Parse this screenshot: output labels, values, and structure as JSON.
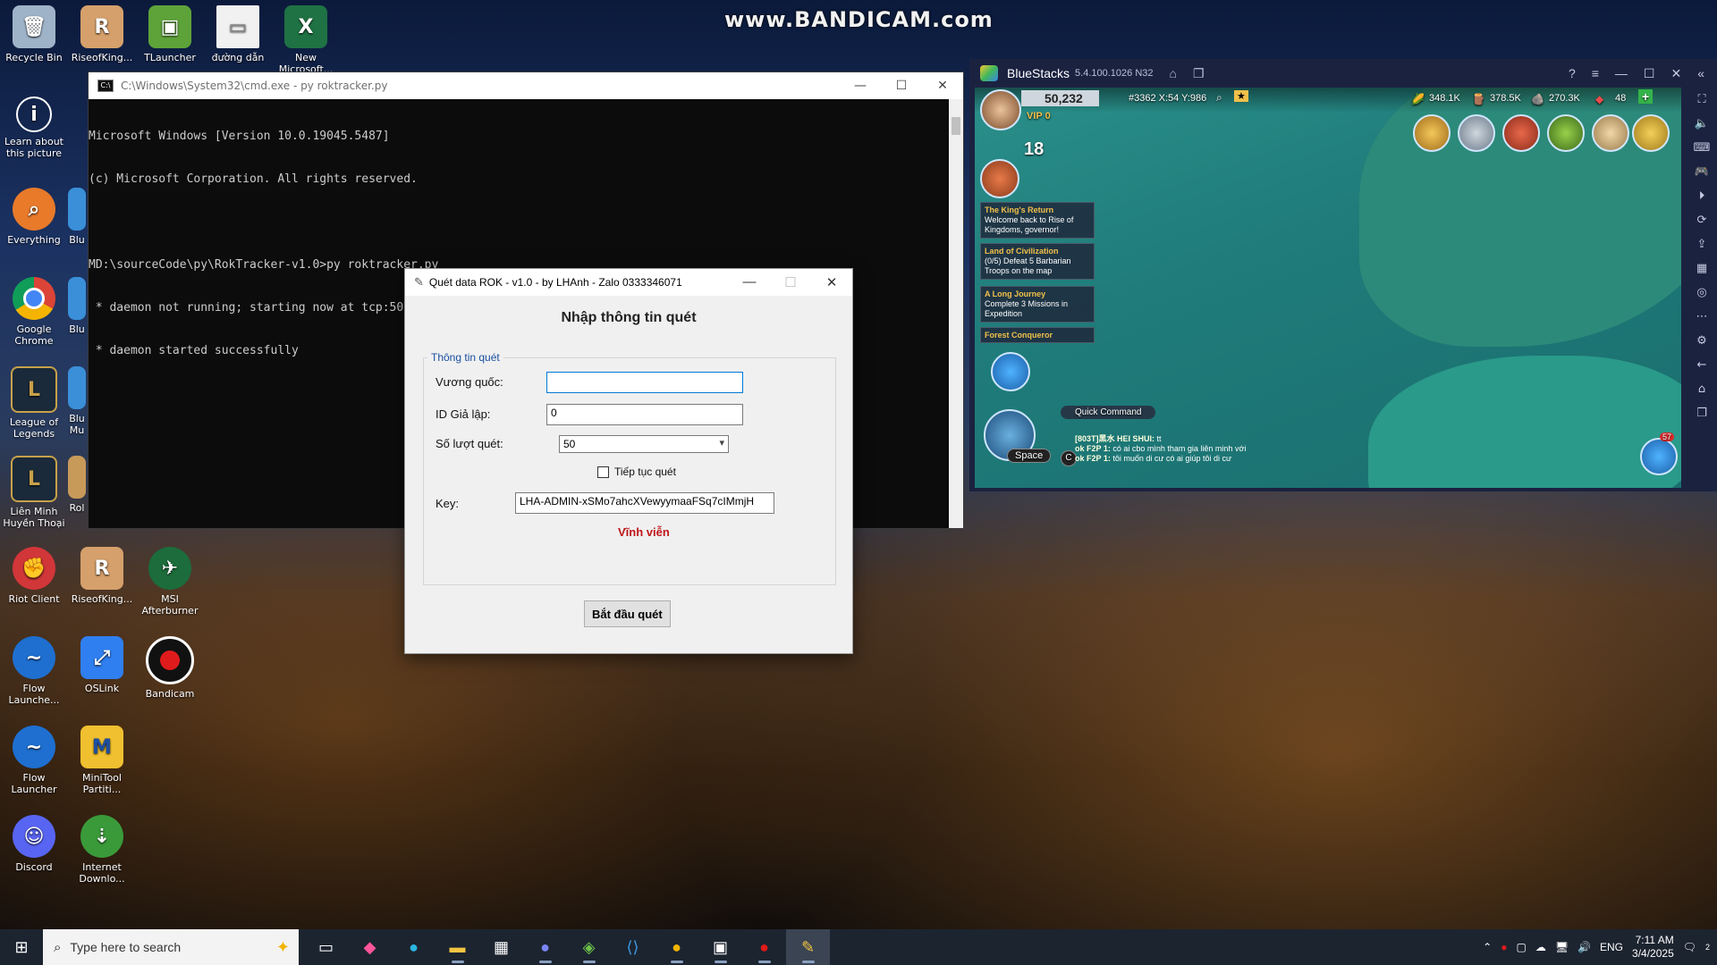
{
  "watermark": "www.BANDICAM.com",
  "desktop": {
    "icons": [
      {
        "label": "Recycle Bin",
        "icon": "recycle-bin-icon"
      },
      {
        "label": "RiseofKing...",
        "icon": "rise-of-kingdoms-icon"
      },
      {
        "label": "TLauncher",
        "icon": "tlauncher-icon"
      },
      {
        "label": "đường dẫn",
        "icon": "file-icon"
      },
      {
        "label": "New Microsoft...",
        "icon": "excel-icon"
      },
      {
        "label": "Learn about this picture",
        "icon": "learn-picture-icon"
      },
      {
        "label": "Everything",
        "icon": "everything-search-icon"
      },
      {
        "label": "Blu",
        "icon": "bluestacks-icon"
      },
      {
        "label": "Google Chrome",
        "icon": "chrome-icon"
      },
      {
        "label": "Blu",
        "icon": "bluestacks-icon"
      },
      {
        "label": "League of Legends",
        "icon": "league-of-legends-icon"
      },
      {
        "label": "Blu Mu",
        "icon": "bluestacks-multi-icon"
      },
      {
        "label": "Liên Minh Huyền Thoại",
        "icon": "lien-minh-icon"
      },
      {
        "label": "Rol",
        "icon": "rol-icon"
      },
      {
        "label": "Riot Client",
        "icon": "riot-client-icon"
      },
      {
        "label": "RiseofKing...",
        "icon": "rise-of-kingdoms-icon"
      },
      {
        "label": "MSI Afterburner",
        "icon": "msi-afterburner-icon"
      },
      {
        "label": "Flow Launche...",
        "icon": "flow-launcher-icon"
      },
      {
        "label": "OSLink",
        "icon": "oslink-icon"
      },
      {
        "label": "Bandicam",
        "icon": "bandicam-icon"
      },
      {
        "label": "Flow Launcher",
        "icon": "flow-launcher-icon"
      },
      {
        "label": "MiniTool Partiti...",
        "icon": "minitool-icon"
      },
      {
        "label": "Discord",
        "icon": "discord-icon"
      },
      {
        "label": "Internet Downlo...",
        "icon": "idm-icon"
      }
    ]
  },
  "cmd": {
    "title": "C:\\Windows\\System32\\cmd.exe - py  roktracker.py",
    "lines": [
      "Microsoft Windows [Version 10.0.19045.5487]",
      "(c) Microsoft Corporation. All rights reserved.",
      "",
      "MD:\\sourceCode\\py\\RokTracker-v1.0>py roktracker.py",
      " * daemon not running; starting now at tcp:5037",
      " * daemon started successfully"
    ]
  },
  "dialog": {
    "title": "Quét data ROK - v1.0 - by LHAnh - Zalo 0333346071",
    "heading": "Nhập thông tin quét",
    "group_label": "Thông tin quét",
    "kingdom_label": "Vương quốc:",
    "kingdom_value": "",
    "emulator_label": "ID Giả lập:",
    "emulator_value": "0",
    "scan_count_label": "Số lượt quét:",
    "scan_count_value": "50",
    "continue_label": "Tiếp tục quét",
    "key_label": "Key:",
    "key_value": "LHA-ADMIN-xSMo7ahcXVewyymaaFSq7cIMmjH",
    "license_status": "Vĩnh viễn",
    "start_button": "Bắt đầu quét"
  },
  "bluestacks": {
    "name": "BlueStacks",
    "version": "5.4.100.1026 N32",
    "game": {
      "power": "50,232",
      "coords": "#3362 X:54 Y:986",
      "vip": "VIP 0",
      "food": "348.1K",
      "wood": "378.5K",
      "stone": "270.3K",
      "gems": "48",
      "action_points": "18",
      "quests": [
        {
          "title": "The King's Return",
          "desc": "Welcome back to Rise of Kingdoms, governor!"
        },
        {
          "title": "Land of Civilization",
          "desc": "(0/5) Defeat 5 Barbarian Troops on the map"
        },
        {
          "title": "A Long Journey",
          "desc": "Complete 3 Missions in Expedition"
        },
        {
          "title": "Forest Conqueror",
          "desc": ""
        }
      ],
      "quick_command": "Quick Command",
      "space_label": "Space",
      "c_label": "C",
      "chat": [
        {
          "name": "[803T]黑水 HEI SHUI:",
          "msg": "tt"
        },
        {
          "name": "ok F2P 1:",
          "msg": "có ai cbo mình tham gia liên minh với"
        },
        {
          "name": "ok F2P 1:",
          "msg": "tôi muốn di cư có ai giúp tôi di cư"
        }
      ],
      "mail_badge": "57"
    }
  },
  "taskbar": {
    "search_placeholder": "Type here to search",
    "lang": "ENG",
    "time": "7:11 AM",
    "date": "3/4/2025",
    "notifications": "2"
  }
}
